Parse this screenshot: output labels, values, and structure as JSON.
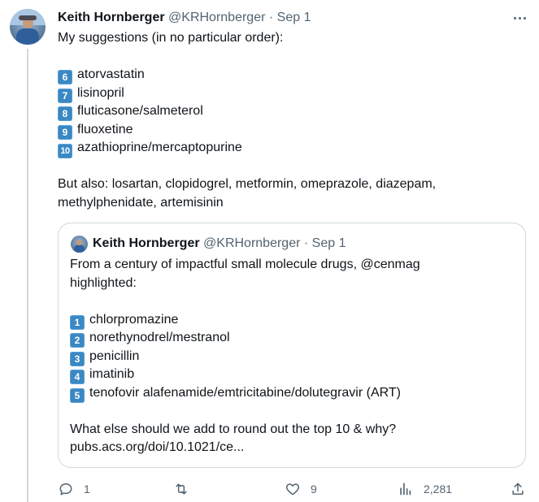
{
  "tweet": {
    "author_name": "Keith Hornberger",
    "author_handle": "@KRHornberger",
    "separator": "·",
    "date": "Sep 1",
    "intro": "My suggestions (in no particular order):",
    "items": [
      {
        "num": "6",
        "text": "atorvastatin"
      },
      {
        "num": "7",
        "text": "lisinopril"
      },
      {
        "num": "8",
        "text": "fluticasone/salmeterol"
      },
      {
        "num": "9",
        "text": "fluoxetine"
      },
      {
        "num": "10",
        "text": "azathioprine/mercaptopurine"
      }
    ],
    "also_line1": "But also: losartan, clopidogrel, metformin, omeprazole, diazepam,",
    "also_line2": "methylphenidate, artemisinin"
  },
  "quote": {
    "author_name": "Keith Hornberger",
    "author_handle": "@KRHornberger",
    "separator": "·",
    "date": "Sep 1",
    "intro_line1": "From a century of impactful small molecule drugs, @cenmag",
    "intro_line2": "highlighted:",
    "items": [
      {
        "num": "1",
        "text": "chlorpromazine"
      },
      {
        "num": "2",
        "text": "norethynodrel/mestranol"
      },
      {
        "num": "3",
        "text": "penicillin"
      },
      {
        "num": "4",
        "text": "imatinib"
      },
      {
        "num": "5",
        "text": "tenofovir alafenamide/emtricitabine/dolutegravir (ART)"
      }
    ],
    "question": "What else should we add to round out the top 10 & why?",
    "link": "pubs.acs.org/doi/10.1021/ce..."
  },
  "actions": {
    "replies": "1",
    "retweets": "",
    "likes": "9",
    "views": "2,281"
  },
  "colors": {
    "text": "#0f1419",
    "muted": "#536471",
    "border": "#cfd9de",
    "keycap": "#3b88c3"
  },
  "icons": [
    "reply-icon",
    "retweet-icon",
    "like-icon",
    "views-icon",
    "share-icon",
    "more-icon"
  ]
}
